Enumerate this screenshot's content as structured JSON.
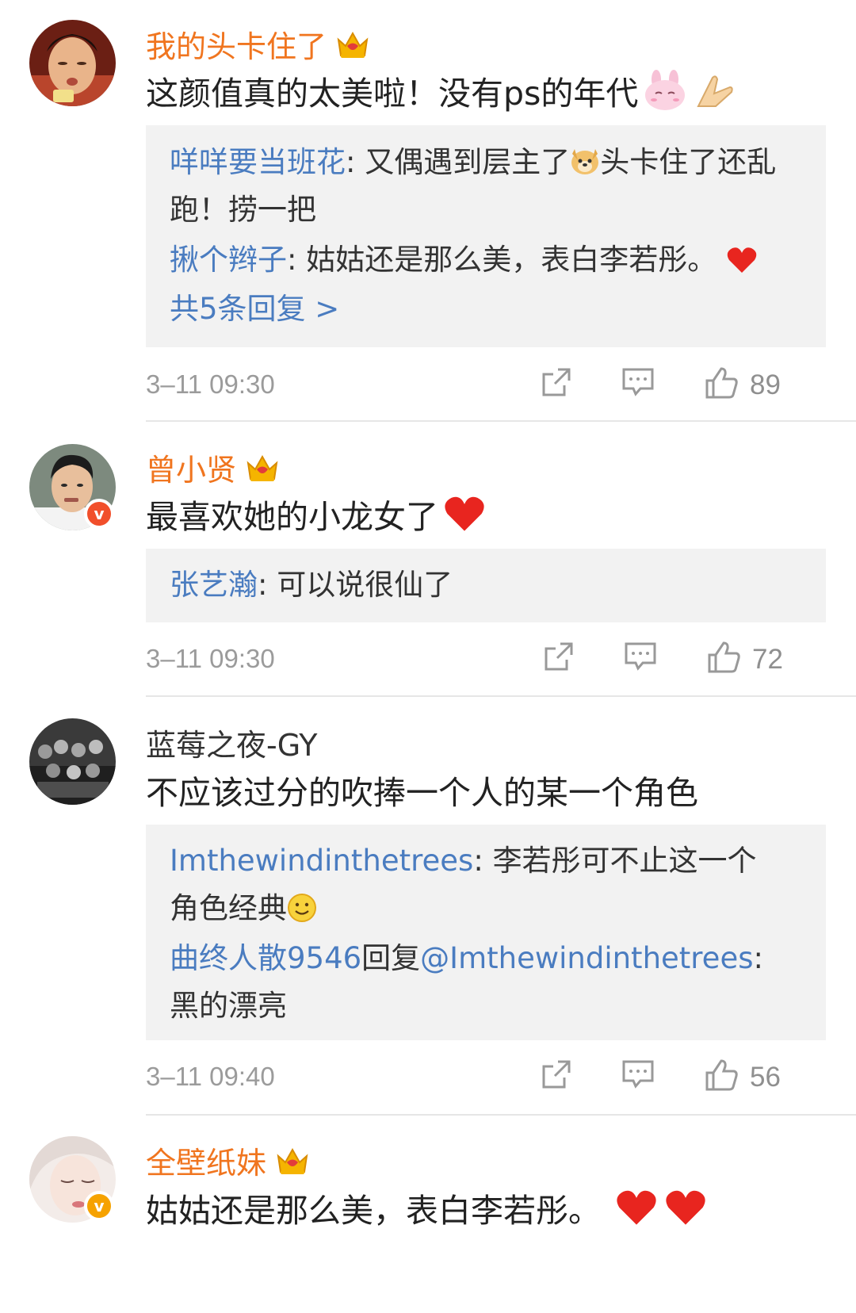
{
  "comments": [
    {
      "username": "我的头卡住了",
      "name_style": "vip",
      "content": "这颜值真的太美啦！没有ps的年代",
      "content_emojis": [
        "bunny-emoji",
        "pray-emoji"
      ],
      "replies": [
        {
          "name": "咩咩要当班花",
          "sep": ": ",
          "text_a": "又偶遇到层主了",
          "emoji": "doge-emoji",
          "text_b": "头卡住了还乱跑！捞一把"
        },
        {
          "name": "揪个辫子",
          "sep": ": ",
          "text_a": "姑姑还是那么美，表白李若彤。",
          "emoji": "heart-emoji",
          "text_b": ""
        }
      ],
      "more": "共5条回复 >",
      "time": "3–11 09:30",
      "likes": "89"
    },
    {
      "username": "曾小贤",
      "name_style": "vip",
      "verified": "red",
      "content": "最喜欢她的小龙女了",
      "content_emojis": [
        "heart-emoji"
      ],
      "replies": [
        {
          "name": "张艺瀚",
          "sep": ": ",
          "text_a": "可以说很仙了",
          "emoji": "",
          "text_b": ""
        }
      ],
      "time": "3–11 09:30",
      "likes": "72"
    },
    {
      "username": "蓝莓之夜-GY",
      "name_style": "plain",
      "content": "不应该过分的吹捧一个人的某一个角色",
      "replies": [
        {
          "name": "Imthewindinthetrees",
          "sep": ": ",
          "text_a": "李若彤可不止这一个角色经典",
          "emoji": "smile-emoji",
          "text_b": ""
        },
        {
          "name": "曲终人散9546",
          "mid": "回复",
          "mention": "@Imthewindinthetrees",
          "sep": ":",
          "text_a": "黑的漂亮",
          "emoji": "",
          "text_b": ""
        }
      ],
      "time": "3–11 09:40",
      "likes": "56"
    },
    {
      "username": "全壁纸妹",
      "name_style": "vip",
      "verified": "orange",
      "content": "姑姑还是那么美，表白李若彤。",
      "content_emojis": [
        "heart-emoji",
        "heart-emoji"
      ]
    }
  ],
  "icons": {
    "share": "share-icon",
    "comment": "comment-icon",
    "like": "thumbs-up-icon",
    "crown": "crown-icon"
  },
  "colors": {
    "vip_name": "#f0751f",
    "reply_name": "#4a7cc0",
    "reply_bg": "#f2f2f2",
    "meta_text": "#9b9b9b"
  }
}
